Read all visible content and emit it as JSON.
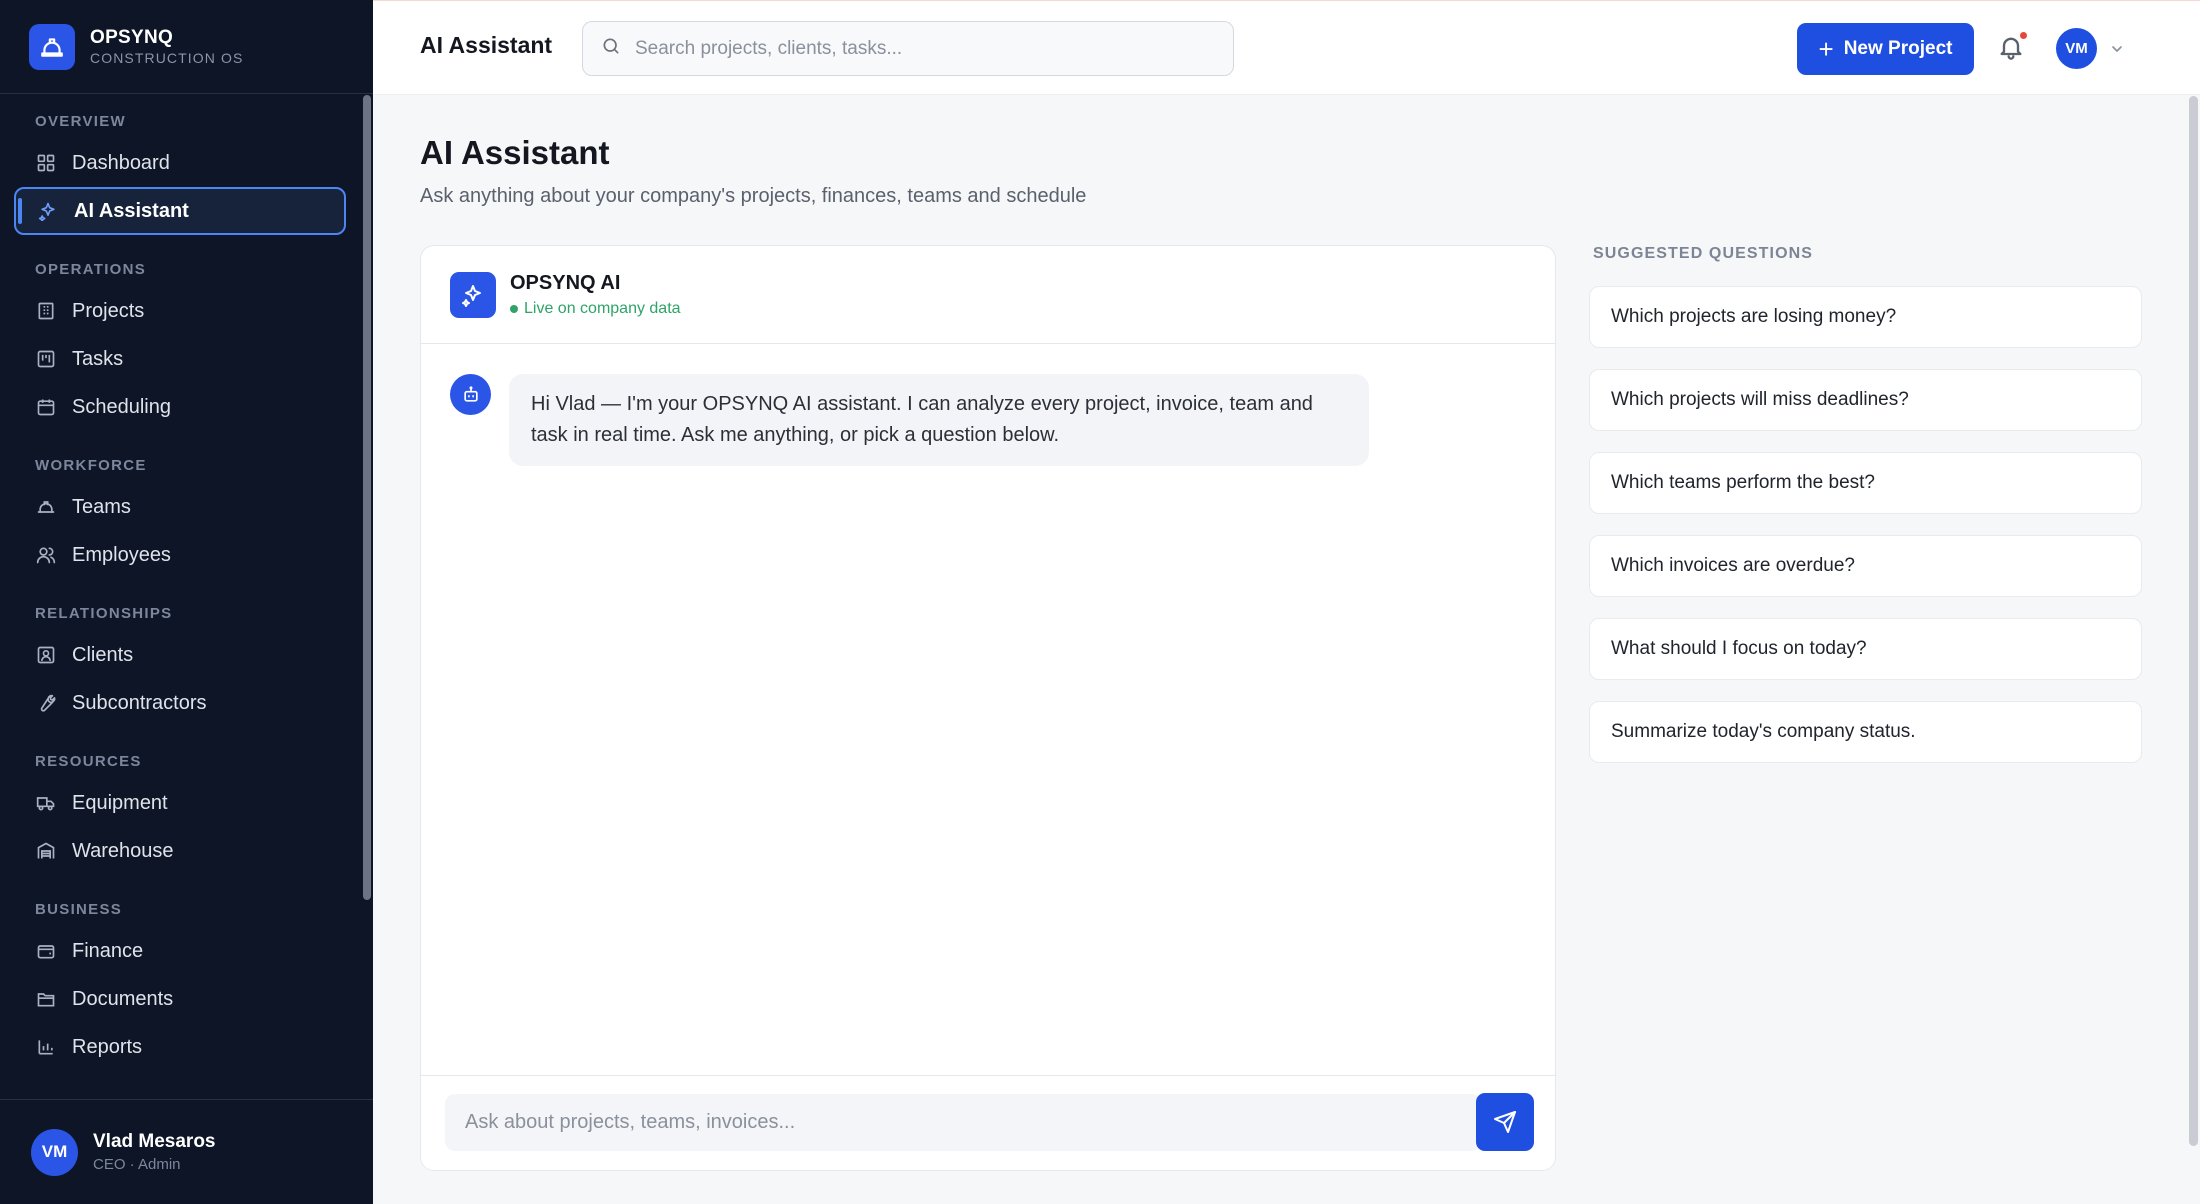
{
  "brand": {
    "name": "OPSYNQ",
    "tagline": "CONSTRUCTION OS"
  },
  "sidebar": {
    "sections": [
      {
        "label": "OVERVIEW",
        "items": [
          {
            "label": "Dashboard",
            "icon": "grid-icon",
            "active": false
          },
          {
            "label": "AI Assistant",
            "icon": "sparkles-icon",
            "active": true
          }
        ]
      },
      {
        "label": "OPERATIONS",
        "items": [
          {
            "label": "Projects",
            "icon": "building-icon",
            "active": false
          },
          {
            "label": "Tasks",
            "icon": "kanban-icon",
            "active": false
          },
          {
            "label": "Scheduling",
            "icon": "calendar-icon",
            "active": false
          }
        ]
      },
      {
        "label": "WORKFORCE",
        "items": [
          {
            "label": "Teams",
            "icon": "hardhat-icon",
            "active": false
          },
          {
            "label": "Employees",
            "icon": "users-icon",
            "active": false
          }
        ]
      },
      {
        "label": "RELATIONSHIPS",
        "items": [
          {
            "label": "Clients",
            "icon": "contact-icon",
            "active": false
          },
          {
            "label": "Subcontractors",
            "icon": "wrench-icon",
            "active": false
          }
        ]
      },
      {
        "label": "RESOURCES",
        "items": [
          {
            "label": "Equipment",
            "icon": "truck-icon",
            "active": false
          },
          {
            "label": "Warehouse",
            "icon": "warehouse-icon",
            "active": false
          }
        ]
      },
      {
        "label": "BUSINESS",
        "items": [
          {
            "label": "Finance",
            "icon": "wallet-icon",
            "active": false
          },
          {
            "label": "Documents",
            "icon": "folder-icon",
            "active": false
          },
          {
            "label": "Reports",
            "icon": "bar-chart-icon",
            "active": false
          }
        ]
      }
    ]
  },
  "user": {
    "initials": "VM",
    "name": "Vlad Mesaros",
    "role": "CEO · Admin"
  },
  "header": {
    "title": "AI Assistant",
    "search_placeholder": "Search projects, clients, tasks...",
    "new_project_label": "New Project",
    "avatar_initials": "VM"
  },
  "page": {
    "title": "AI Assistant",
    "subtitle": "Ask anything about your company's projects, finances, teams and schedule"
  },
  "chat": {
    "assistant_name": "OPSYNQ AI",
    "status": "Live on company data",
    "messages": [
      {
        "from": "assistant",
        "text": "Hi Vlad — I'm your OPSYNQ AI assistant. I can analyze every project, invoice, team and task in real time. Ask me anything, or pick a question below."
      }
    ],
    "input_placeholder": "Ask about projects, teams, invoices..."
  },
  "suggestions": {
    "label": "SUGGESTED QUESTIONS",
    "items": [
      "Which projects are losing money?",
      "Which projects will miss deadlines?",
      "Which teams perform the best?",
      "Which invoices are overdue?",
      "What should I focus on today?",
      "Summarize today's company status."
    ]
  },
  "colors": {
    "sidebar_bg": "#0d1527",
    "accent": "#1f4fe0",
    "active_border": "#4c86f5",
    "live_green": "#2fa368",
    "notification_dot": "#e5483b"
  }
}
